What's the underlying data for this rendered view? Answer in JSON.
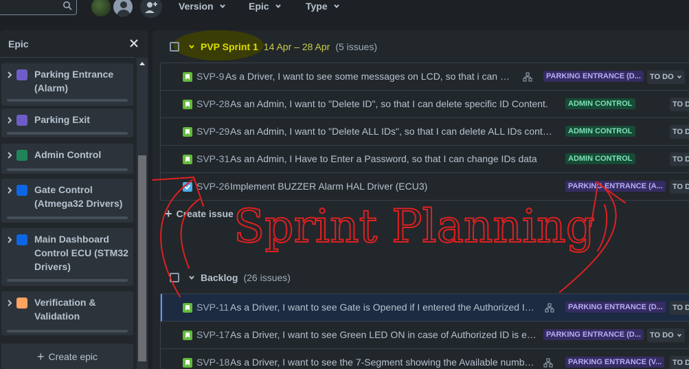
{
  "topbar": {
    "filters": [
      {
        "label": "Version"
      },
      {
        "label": "Epic"
      },
      {
        "label": "Type"
      }
    ]
  },
  "epic_panel": {
    "title": "Epic",
    "epics": [
      {
        "name": "Parking Entrance (Alarm)",
        "color": "#6e5dc6"
      },
      {
        "name": "Parking Exit",
        "color": "#6e5dc6"
      },
      {
        "name": "Admin Control",
        "color": "#1f845a"
      },
      {
        "name": "Gate Control (Atmega32 Drivers)",
        "color": "#0c66e4"
      },
      {
        "name": "Main Dashboard Control ECU (STM32 Drivers)",
        "color": "#0c66e4"
      },
      {
        "name": "Verification & Validation",
        "color": "#fea362"
      }
    ],
    "create_label": "Create epic"
  },
  "sprint": {
    "title": "PVP Sprint 1",
    "dates": "14 Apr – 28 Apr",
    "count": "(5 issues)",
    "issues": [
      {
        "key": "SVP-9",
        "summary": "As a Driver, I want to see some messages on LCD, so that i can und...",
        "epic": "PARKING ENTRANCE (D...",
        "status": "TO DO",
        "type": "story"
      },
      {
        "key": "SVP-28",
        "summary": "As an Admin, I want to \"Delete ID\", so that I can delete specific ID Content.",
        "epic": "ADMIN CONTROL",
        "status": "TO D",
        "type": "story"
      },
      {
        "key": "SVP-29",
        "summary": "As an Admin, I want to \"Delete ALL IDs\", so that I can delete ALL IDs content.",
        "epic": "ADMIN CONTROL",
        "status": "TO D",
        "type": "story"
      },
      {
        "key": "SVP-31",
        "summary": "As an Admin, I Have to Enter a Password, so that I can change IDs data",
        "epic": "ADMIN CONTROL",
        "status": "TO D",
        "type": "story"
      },
      {
        "key": "SVP-26",
        "summary": "Implement BUZZER Alarm HAL Driver (ECU3)",
        "epic": "PARKING ENTRANCE (A...",
        "status": "TO D",
        "type": "task"
      }
    ],
    "create_issue_label": "Create issue"
  },
  "backlog": {
    "title": "Backlog",
    "count": "(26 issues)",
    "issues": [
      {
        "key": "SVP-11",
        "summary": "As a Driver, I want to see Gate is Opened if I entered the Authorized ID,...",
        "epic": "PARKING ENTRANCE (D...",
        "status": "TO D",
        "type": "story"
      },
      {
        "key": "SVP-17",
        "summary": "As a Driver, I want to see Green LED ON in case of Authorized ID is en...",
        "epic": "PARKING ENTRANCE (D...",
        "status": "TO DO",
        "type": "story"
      },
      {
        "key": "SVP-18",
        "summary": "As a Driver, I want to see the 7-Segment showing the Available numbe...",
        "epic": "PARKING ENTRANCE (V...",
        "status": "TO D",
        "type": "story"
      }
    ]
  },
  "annotation_text": "Sprint Planning",
  "colors": {
    "background": "#1d2125",
    "panel": "#22272b",
    "sprint_title": "#dcdf00",
    "highlight": "#4a4d00",
    "story": "#63ba3c",
    "task": "#4bade8",
    "annotation": "#e02020"
  }
}
